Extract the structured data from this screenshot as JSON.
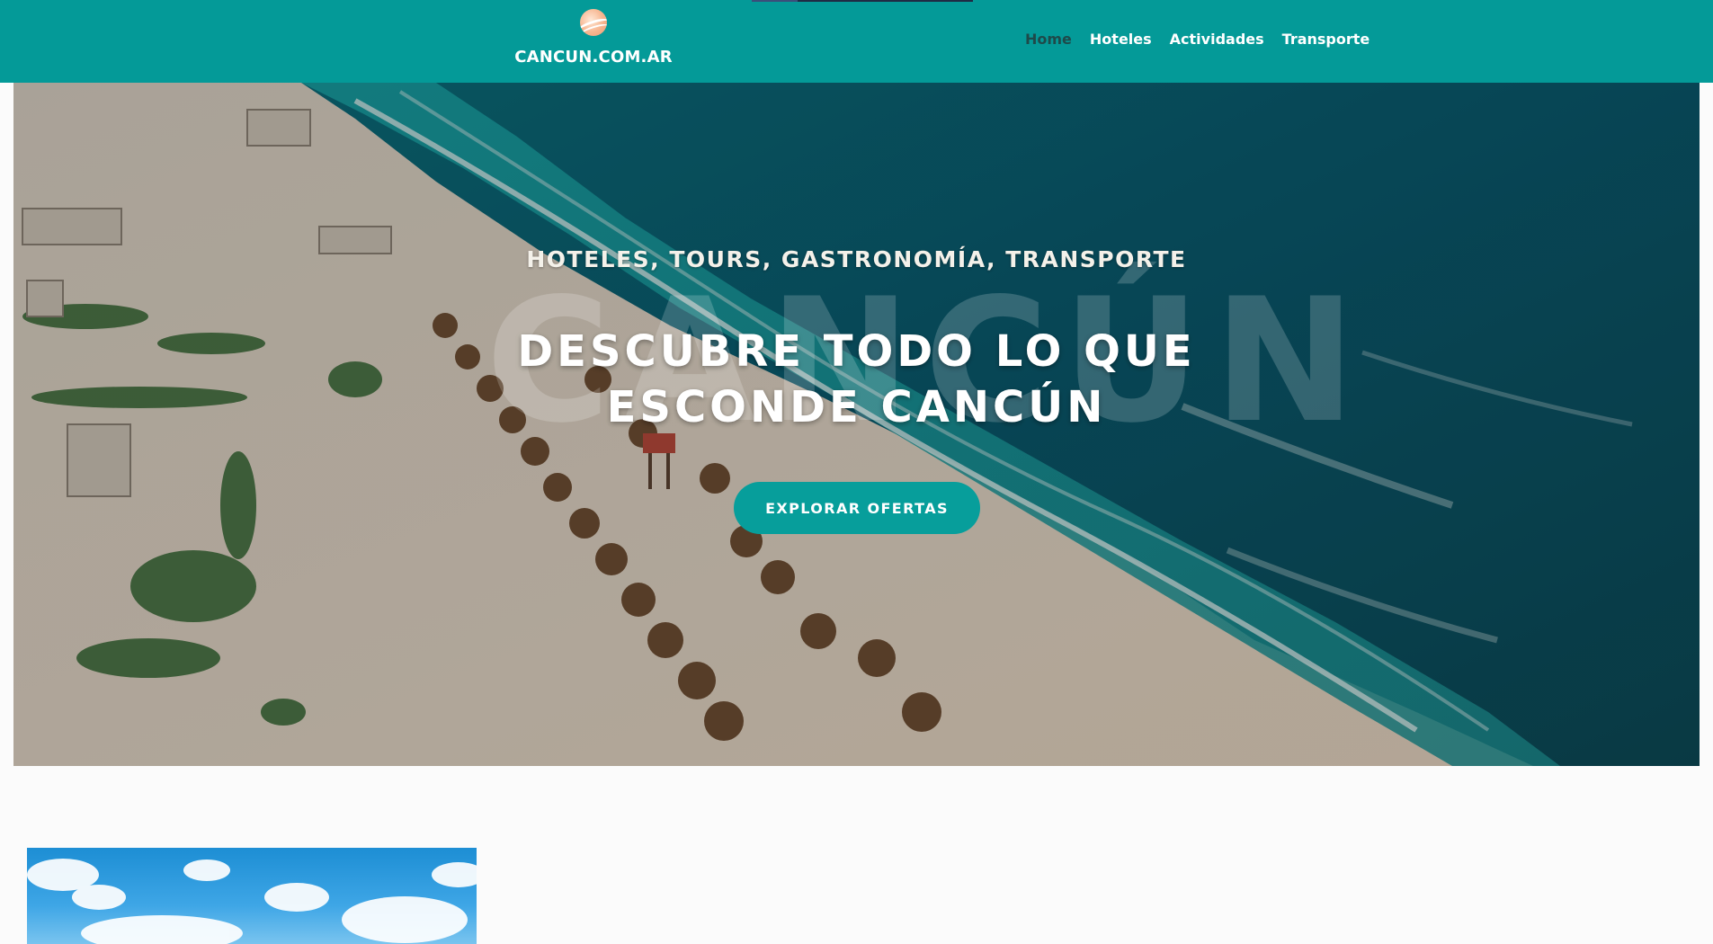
{
  "header": {
    "brand": "CANCUN.COM.AR",
    "logo_icon": "sun-wave-logo",
    "bg_color": "#049a98",
    "nav": [
      {
        "label": "Home",
        "active": true
      },
      {
        "label": "Hoteles",
        "active": false
      },
      {
        "label": "Actividades",
        "active": false
      },
      {
        "label": "Transporte",
        "active": false
      }
    ]
  },
  "hero": {
    "kicker": "HOTELES, TOURS, GASTRONOMÍA, TRANSPORTE",
    "title_line1": "DESCUBRE TODO LO QUE",
    "title_line2": "ESCONDE CANCÚN",
    "watermark": "CANCÚN",
    "cta_label": "EXPLORAR OFERTAS",
    "accent_color": "#079e9b"
  }
}
